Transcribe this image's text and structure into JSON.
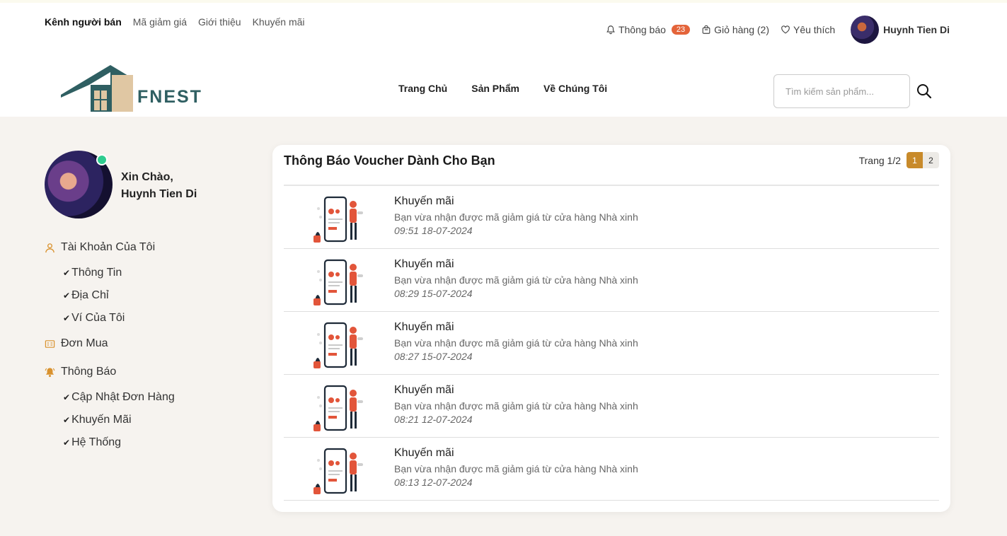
{
  "topbar": {
    "links": [
      "Kênh người bán",
      "Mã giảm giá",
      "Giới thiệu",
      "Khuyến mãi"
    ],
    "notifications_label": "Thông báo",
    "notifications_count": "23",
    "cart_label": "Giỏ hàng (2)",
    "wishlist_label": "Yêu thích",
    "user_name": "Huynh Tien Di"
  },
  "brand": {
    "logo_text": "FNEST",
    "colors": {
      "primary": "#2f5f62",
      "accent": "#e0c7a3"
    }
  },
  "nav": {
    "items": [
      "Trang Chủ",
      "Sản Phẩm",
      "Về Chúng Tôi"
    ]
  },
  "search": {
    "placeholder": "Tìm kiếm sản phẩm..."
  },
  "profile": {
    "greeting": "Xin Chào,",
    "name": "Huynh Tien Di"
  },
  "sidebar": {
    "account": "Tài Khoản Của Tôi",
    "account_items": [
      "Thông Tin",
      "Địa Chỉ",
      "Ví Của Tôi"
    ],
    "orders": "Đơn Mua",
    "notifications": "Thông Báo",
    "notification_items": [
      "Cập Nhật Đơn Hàng",
      "Khuyến Mãi",
      "Hệ Thống"
    ]
  },
  "panel": {
    "title": "Thông Báo Voucher Dành Cho Bạn",
    "page_label": "Trang 1/2",
    "pages": [
      "1",
      "2"
    ],
    "active_color": "#c88a2a"
  },
  "notifications": [
    {
      "title": "Khuyến mãi",
      "description": "Bạn vừa nhận được mã giảm giá từ cửa hàng Nhà xinh",
      "time": "09:51 18-07-2024"
    },
    {
      "title": "Khuyến mãi",
      "description": "Bạn vừa nhận được mã giảm giá từ cửa hàng Nhà xinh",
      "time": "08:29 15-07-2024"
    },
    {
      "title": "Khuyến mãi",
      "description": "Bạn vừa nhận được mã giảm giá từ cửa hàng Nhà xinh",
      "time": "08:27 15-07-2024"
    },
    {
      "title": "Khuyến mãi",
      "description": "Bạn vừa nhận được mã giảm giá từ cửa hàng Nhà xinh",
      "time": "08:21 12-07-2024"
    },
    {
      "title": "Khuyến mãi",
      "description": "Bạn vừa nhận được mã giảm giá từ cửa hàng Nhà xinh",
      "time": "08:13 12-07-2024"
    }
  ]
}
